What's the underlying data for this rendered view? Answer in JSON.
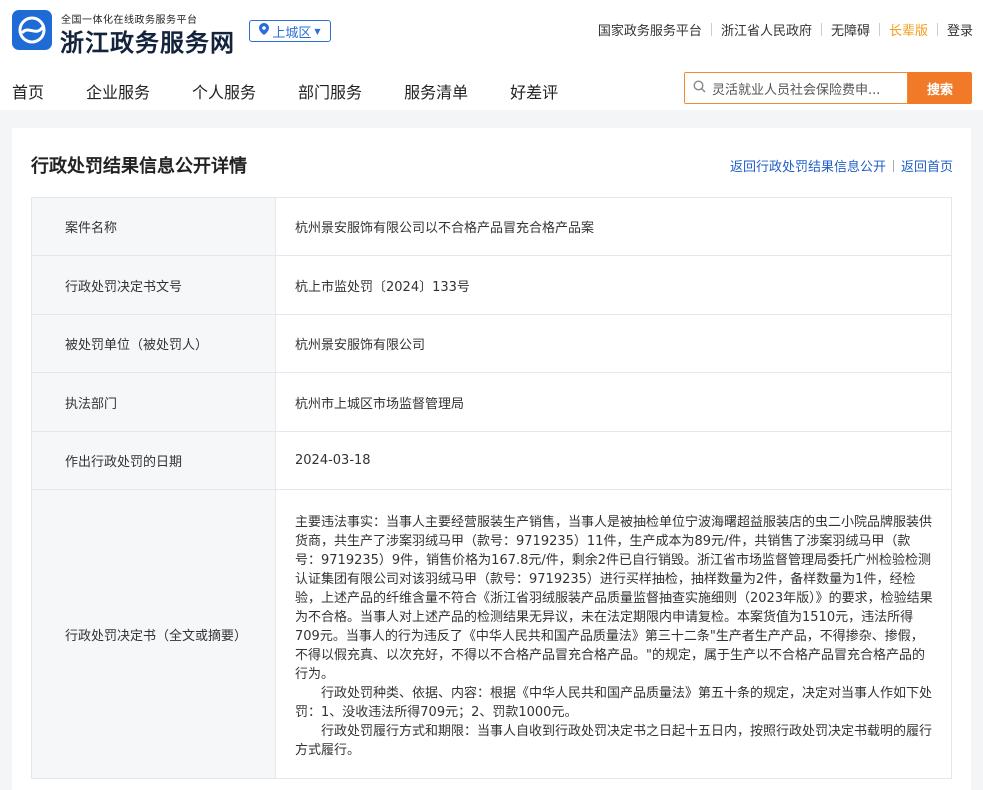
{
  "header": {
    "logo_small": "全国一体化在线政务服务平台",
    "logo_big": "浙江政务服务网",
    "region": "上城区",
    "top_links": [
      "国家政务服务平台",
      "浙江省人民政府",
      "无障碍",
      "长辈版",
      "登录"
    ]
  },
  "nav": {
    "items": [
      "首页",
      "企业服务",
      "个人服务",
      "部门服务",
      "服务清单",
      "好差评"
    ]
  },
  "search": {
    "placeholder": "灵活就业人员社会保险费申...",
    "button": "搜索"
  },
  "page": {
    "title": "行政处罚结果信息公开详情",
    "link_back_list": "返回行政处罚结果信息公开",
    "link_home": "返回首页"
  },
  "details": [
    {
      "label": "案件名称",
      "value": "杭州景安服饰有限公司以不合格产品冒充合格产品案"
    },
    {
      "label": "行政处罚决定书文号",
      "value": "杭上市监处罚〔2024〕133号"
    },
    {
      "label": "被处罚单位（被处罚人）",
      "value": "杭州景安服饰有限公司"
    },
    {
      "label": "执法部门",
      "value": "杭州市上城区市场监督管理局"
    },
    {
      "label": "作出行政处罚的日期",
      "value": "2024-03-18"
    }
  ],
  "decision": {
    "label": "行政处罚决定书（全文或摘要）",
    "paragraphs": [
      "主要违法事实：当事人主要经营服装生产销售，当事人是被抽检单位宁波海曙超益服装店的虫二小院品牌服装供货商，共生产了涉案羽绒马甲（款号：9719235）11件，生产成本为89元/件，共销售了涉案羽绒马甲（款号：9719235）9件，销售价格为167.8元/件，剩余2件已自行销毁。浙江省市场监督管理局委托广州检验检测认证集团有限公司对该羽绒马甲（款号：9719235）进行买样抽检，抽样数量为2件，备样数量为1件，经检验，上述产品的纤维含量不符合《浙江省羽绒服装产品质量监督抽查实施细则（2023年版）》的要求，检验结果为不合格。当事人对上述产品的检测结果无异议，未在法定期限内申请复检。本案货值为1510元，违法所得709元。当事人的行为违反了《中华人民共和国产品质量法》第三十二条\"生产者生产产品，不得掺杂、掺假，不得以假充真、以次充好，不得以不合格产品冒充合格产品。\"的规定，属于生产以不合格产品冒充合格产品的行为。",
      "行政处罚种类、依据、内容：根据《中华人民共和国产品质量法》第五十条的规定，决定对当事人作如下处罚：1、没收违法所得709元；2、罚款1000元。",
      "行政处罚履行方式和期限：当事人自收到行政处罚决定书之日起十五日内，按照行政处罚决定书载明的履行方式履行。"
    ]
  }
}
